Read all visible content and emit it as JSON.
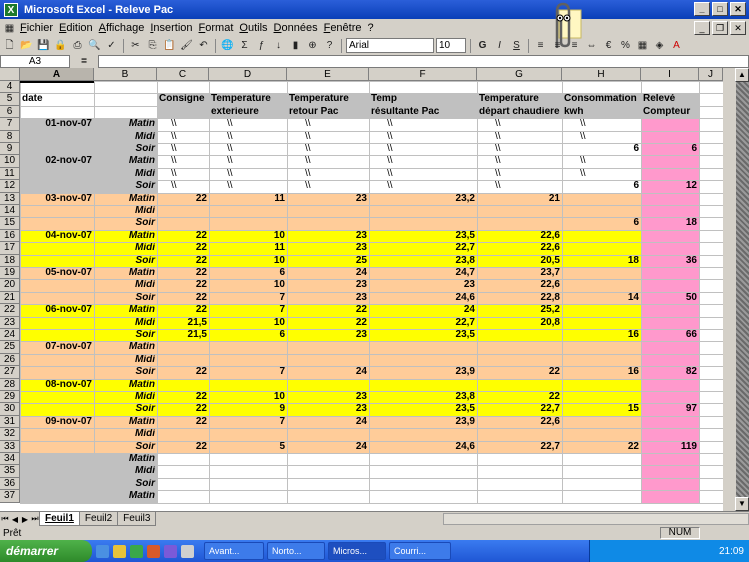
{
  "window": {
    "title": "Microsoft Excel - Releve Pac"
  },
  "menu": [
    "Fichier",
    "Edition",
    "Affichage",
    "Insertion",
    "Format",
    "Outils",
    "Données",
    "Fenêtre",
    "?"
  ],
  "toolbar": {
    "font": "Arial",
    "size": "10",
    "bold": "G",
    "italic": "I",
    "underline": "S"
  },
  "formula": {
    "namebox": "A3",
    "fx": "="
  },
  "columns": [
    "A",
    "B",
    "C",
    "D",
    "E",
    "F",
    "G",
    "H",
    "I",
    "J"
  ],
  "headers": {
    "date": "date",
    "c1": "Consigne",
    "d1": "Temperature",
    "d2": "exterieure",
    "e1": "Temperature",
    "e2": "retour Pac",
    "f1": "Temp",
    "f2": "résultante Pac",
    "g1": "Temperature",
    "g2": "départ chaudiere",
    "h1": "Consommation",
    "h2": "kwh",
    "i1": "Relevé",
    "i2": "Compteur"
  },
  "rows": [
    {
      "n": "7",
      "date": "01-nov-07",
      "p": "Matin",
      "c": "\\\\",
      "d": "\\\\",
      "e": "\\\\",
      "f": "\\\\",
      "g": "\\\\",
      "h": "\\\\",
      "i": ""
    },
    {
      "n": "8",
      "date": "",
      "p": "Midi",
      "c": "\\\\",
      "d": "\\\\",
      "e": "\\\\",
      "f": "\\\\",
      "g": "\\\\",
      "h": "\\\\",
      "i": ""
    },
    {
      "n": "9",
      "date": "",
      "p": "Soir",
      "c": "\\\\",
      "d": "\\\\",
      "e": "\\\\",
      "f": "\\\\",
      "g": "\\\\",
      "h": "6",
      "i": "6"
    },
    {
      "n": "10",
      "date": "02-nov-07",
      "p": "Matin",
      "c": "\\\\",
      "d": "\\\\",
      "e": "\\\\",
      "f": "\\\\",
      "g": "\\\\",
      "h": "\\\\",
      "i": ""
    },
    {
      "n": "11",
      "date": "",
      "p": "Midi",
      "c": "\\\\",
      "d": "\\\\",
      "e": "\\\\",
      "f": "\\\\",
      "g": "\\\\",
      "h": "\\\\",
      "i": ""
    },
    {
      "n": "12",
      "date": "",
      "p": "Soir",
      "c": "\\\\",
      "d": "\\\\",
      "e": "\\\\",
      "f": "\\\\",
      "g": "\\\\",
      "h": "6",
      "i": "12"
    },
    {
      "n": "13",
      "date": "03-nov-07",
      "p": "Matin",
      "c": "22",
      "d": "11",
      "e": "23",
      "f": "23,2",
      "g": "21",
      "h": "",
      "i": ""
    },
    {
      "n": "14",
      "date": "",
      "p": "Midi",
      "c": "",
      "d": "",
      "e": "",
      "f": "",
      "g": "",
      "h": "",
      "i": ""
    },
    {
      "n": "15",
      "date": "",
      "p": "Soir",
      "c": "",
      "d": "",
      "e": "",
      "f": "",
      "g": "",
      "h": "6",
      "i": "18"
    },
    {
      "n": "16",
      "date": "04-nov-07",
      "p": "Matin",
      "c": "22",
      "d": "10",
      "e": "23",
      "f": "23,5",
      "g": "22,6",
      "h": "",
      "i": ""
    },
    {
      "n": "17",
      "date": "",
      "p": "Midi",
      "c": "22",
      "d": "11",
      "e": "23",
      "f": "22,7",
      "g": "22,6",
      "h": "",
      "i": ""
    },
    {
      "n": "18",
      "date": "",
      "p": "Soir",
      "c": "22",
      "d": "10",
      "e": "25",
      "f": "23,8",
      "g": "20,5",
      "h": "18",
      "i": "36"
    },
    {
      "n": "19",
      "date": "05-nov-07",
      "p": "Matin",
      "c": "22",
      "d": "6",
      "e": "24",
      "f": "24,7",
      "g": "23,7",
      "h": "",
      "i": ""
    },
    {
      "n": "20",
      "date": "",
      "p": "Midi",
      "c": "22",
      "d": "10",
      "e": "23",
      "f": "23",
      "g": "22,6",
      "h": "",
      "i": ""
    },
    {
      "n": "21",
      "date": "",
      "p": "Soir",
      "c": "22",
      "d": "7",
      "e": "23",
      "f": "24,6",
      "g": "22,8",
      "h": "14",
      "i": "50"
    },
    {
      "n": "22",
      "date": "06-nov-07",
      "p": "Matin",
      "c": "22",
      "d": "7",
      "e": "22",
      "f": "24",
      "g": "25,2",
      "h": "",
      "i": ""
    },
    {
      "n": "23",
      "date": "",
      "p": "Midi",
      "c": "21,5",
      "d": "10",
      "e": "22",
      "f": "22,7",
      "g": "20,8",
      "h": "",
      "i": ""
    },
    {
      "n": "24",
      "date": "",
      "p": "Soir",
      "c": "21,5",
      "d": "6",
      "e": "23",
      "f": "23,5",
      "g": "",
      "h": "16",
      "i": "66"
    },
    {
      "n": "25",
      "date": "07-nov-07",
      "p": "Matin",
      "c": "",
      "d": "",
      "e": "",
      "f": "",
      "g": "",
      "h": "",
      "i": ""
    },
    {
      "n": "26",
      "date": "",
      "p": "Midi",
      "c": "",
      "d": "",
      "e": "",
      "f": "",
      "g": "",
      "h": "",
      "i": ""
    },
    {
      "n": "27",
      "date": "",
      "p": "Soir",
      "c": "22",
      "d": "7",
      "e": "24",
      "f": "23,9",
      "g": "22",
      "h": "16",
      "i": "82"
    },
    {
      "n": "28",
      "date": "08-nov-07",
      "p": "Matin",
      "c": "",
      "d": "",
      "e": "",
      "f": "",
      "g": "",
      "h": "",
      "i": ""
    },
    {
      "n": "29",
      "date": "",
      "p": "Midi",
      "c": "22",
      "d": "10",
      "e": "23",
      "f": "23,8",
      "g": "22",
      "h": "",
      "i": ""
    },
    {
      "n": "30",
      "date": "",
      "p": "Soir",
      "c": "22",
      "d": "9",
      "e": "23",
      "f": "23,5",
      "g": "22,7",
      "h": "15",
      "i": "97"
    },
    {
      "n": "31",
      "date": "09-nov-07",
      "p": "Matin",
      "c": "22",
      "d": "7",
      "e": "24",
      "f": "23,9",
      "g": "22,6",
      "h": "",
      "i": ""
    },
    {
      "n": "32",
      "date": "",
      "p": "Midi",
      "c": "",
      "d": "",
      "e": "",
      "f": "",
      "g": "",
      "h": "",
      "i": ""
    },
    {
      "n": "33",
      "date": "",
      "p": "Soir",
      "c": "22",
      "d": "5",
      "e": "24",
      "f": "24,6",
      "g": "22,7",
      "h": "22",
      "i": "119"
    },
    {
      "n": "34",
      "date": "",
      "p": "Matin",
      "c": "",
      "d": "",
      "e": "",
      "f": "",
      "g": "",
      "h": "",
      "i": ""
    },
    {
      "n": "35",
      "date": "",
      "p": "Midi",
      "c": "",
      "d": "",
      "e": "",
      "f": "",
      "g": "",
      "h": "",
      "i": ""
    },
    {
      "n": "36",
      "date": "",
      "p": "Soir",
      "c": "",
      "d": "",
      "e": "",
      "f": "",
      "g": "",
      "h": "",
      "i": ""
    },
    {
      "n": "37",
      "date": "",
      "p": "Matin",
      "c": "",
      "d": "",
      "e": "",
      "f": "",
      "g": "",
      "h": "",
      "i": ""
    }
  ],
  "colors": {
    "gray": "#c0c0c0",
    "peach": "#ffcc99",
    "yellow": "#ffff00",
    "pink": "#ff99cc"
  },
  "sheets": [
    "Feuil1",
    "Feuil2",
    "Feuil3"
  ],
  "status": {
    "left": "Prêt",
    "num": "NUM"
  },
  "taskbar": {
    "start": "démarrer",
    "tasks": [
      "Avant...",
      "Norto...",
      "Micros...",
      "Courri..."
    ],
    "clock": "21:09"
  }
}
